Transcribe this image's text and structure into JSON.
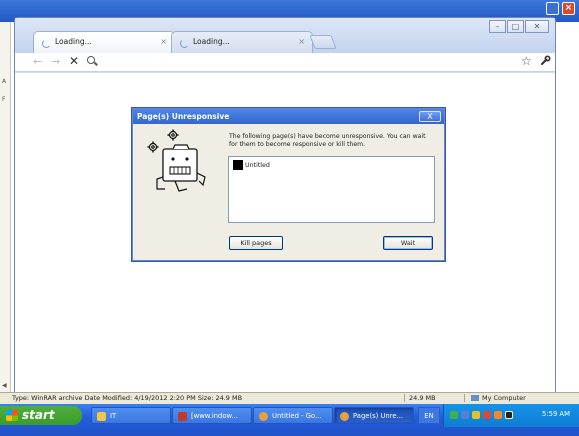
{
  "desktop": {
    "status_type": "Type: WinRAR archive Date Modified: 4/19/2012 2:20 PM Size: 24.9 MB",
    "status_size": "24.9 MB",
    "status_location": "My Computer"
  },
  "browser": {
    "tabs": [
      {
        "label": "Loading...",
        "close": "×"
      },
      {
        "label": "Loading...",
        "close": "×"
      }
    ],
    "omnibox_value": "",
    "buttons": {
      "back": "←",
      "forward": "→",
      "stop": "✕",
      "star": "☆",
      "wrench": "🔧"
    },
    "window_controls": {
      "minimize": "–",
      "maximize": "□",
      "close": "✕"
    }
  },
  "dialog": {
    "title": "Page(s) Unresponsive",
    "close": "X",
    "message": "The following page(s) have become unresponsive. You can wait for them to become responsive or kill them.",
    "pages": [
      {
        "title": "Untitled"
      }
    ],
    "kill_label": "Kill pages",
    "wait_label": "Wait"
  },
  "taskbar": {
    "start_label": "start",
    "tasks": [
      {
        "label": "IT",
        "icon_color": "#f3c64a"
      },
      {
        "label": "[www.indow...",
        "icon_color": "#c0392b"
      },
      {
        "label": "Untitled - Go...",
        "icon_color": "#e8a13a"
      },
      {
        "label": "Page(s) Unre...",
        "icon_color": "#e8a13a"
      }
    ],
    "language": "EN",
    "clock": "5:59 AM"
  },
  "colors": {
    "xp_blue": "#245edb",
    "start_green": "#3a9c2a",
    "dialog_title": "#3566cc",
    "chrome_frame": "#cfdcf2"
  }
}
